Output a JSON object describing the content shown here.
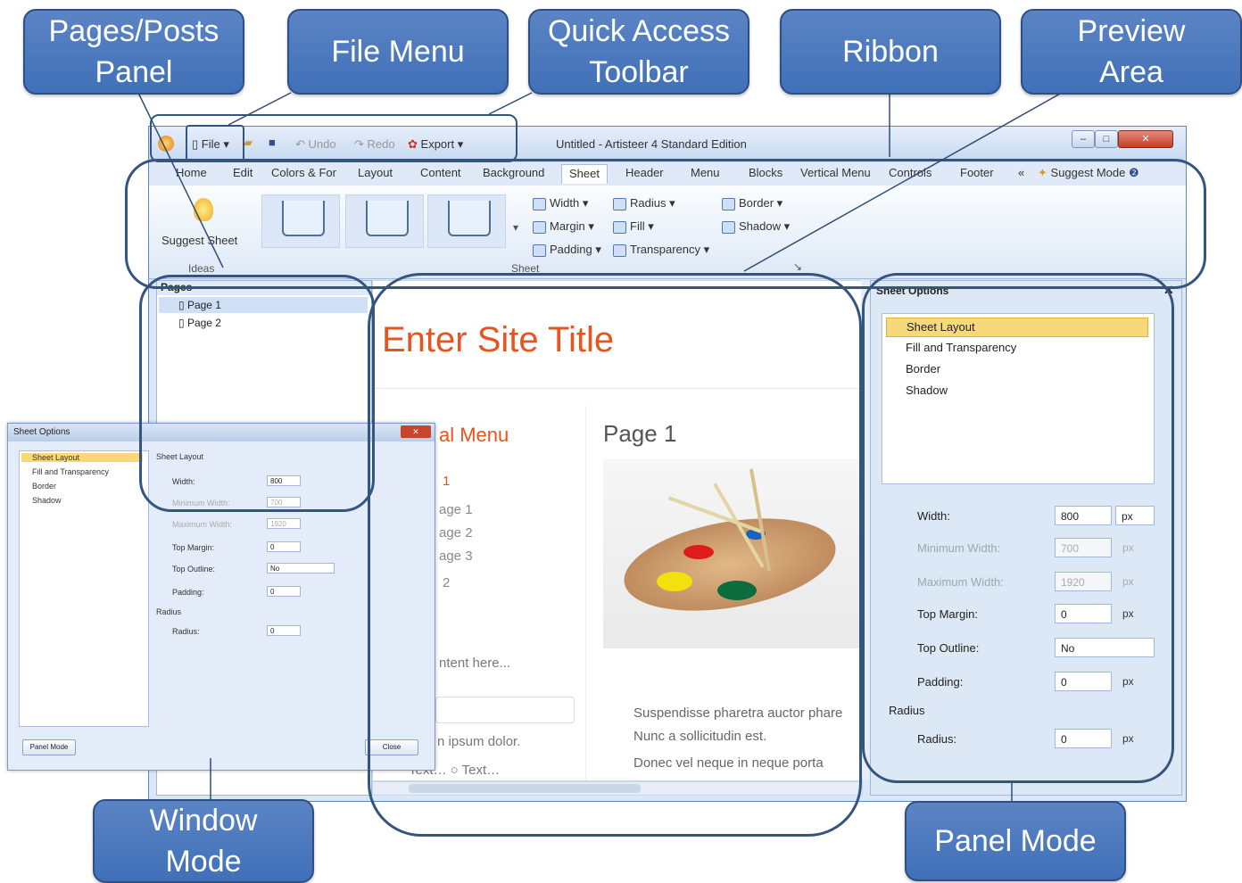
{
  "callouts": {
    "pages_posts_panel": "Pages/Posts\nPanel",
    "file_menu": "File Menu",
    "quick_access_toolbar": "Quick Access\nToolbar",
    "ribbon": "Ribbon",
    "preview_area": "Preview\nArea",
    "window_mode": "Window\nMode",
    "panel_mode": "Panel Mode"
  },
  "titlebar": {
    "file": "File",
    "undo": "Undo",
    "redo": "Redo",
    "export": "Export",
    "title": "Untitled - Artisteer 4 Standard Edition"
  },
  "tabs": [
    "Home",
    "Edit",
    "Colors & For",
    "Layout",
    "Content",
    "Background",
    "Sheet",
    "Header",
    "Menu",
    "Blocks",
    "Vertical Menu",
    "Controls",
    "Footer",
    "«",
    "Suggest Mode"
  ],
  "ribbon": {
    "suggest_sheet": "Suggest Sheet",
    "ideas_group": "Ideas",
    "sheet_group": "Sheet",
    "width": "Width",
    "margin": "Margin",
    "padding": "Padding",
    "radius": "Radius",
    "fill": "Fill",
    "transparency": "Transparency",
    "border": "Border",
    "shadow": "Shadow"
  },
  "pages_panel": {
    "header": "Pages",
    "items": [
      "Page 1",
      "Page 2"
    ]
  },
  "preview": {
    "site_title": "Enter Site Title",
    "vmenu_title": "al Menu",
    "vmenu_items": [
      "1",
      "age 1",
      "age 2",
      "age 3",
      "2"
    ],
    "content_snip": "ntent here...",
    "lorem": "n ipsum dolor.",
    "radio_text": "Text",
    "radio_text2": "Text",
    "page_heading": "Page 1",
    "bullets": [
      "Suspendisse pharetra auctor phare",
      "Nunc a sollicitudin est.",
      "Donec vel neque in neque porta"
    ]
  },
  "sheet_options": {
    "header": "Sheet Options",
    "list": [
      "Sheet Layout",
      "Fill and Transparency",
      "Border",
      "Shadow"
    ],
    "width_label": "Width:",
    "width_value": "800",
    "width_unit": "px",
    "min_width_label": "Minimum Width:",
    "min_width_value": "700",
    "max_width_label": "Maximum Width:",
    "max_width_value": "1920",
    "top_margin_label": "Top Margin:",
    "top_margin_value": "0",
    "top_outline_label": "Top Outline:",
    "top_outline_value": "No",
    "padding_label": "Padding:",
    "padding_value": "0",
    "radius_section": "Radius",
    "radius_label": "Radius:",
    "radius_value": "0",
    "unit": "px"
  },
  "window_mode": {
    "title": "Sheet Options",
    "section": "Sheet Layout",
    "panel_mode_button": "Panel Mode",
    "close_button": "Close"
  },
  "colors": {
    "callout_fill": "#4a78bd",
    "site_title": "#e8541e",
    "selected_item": "#f8d97a"
  }
}
